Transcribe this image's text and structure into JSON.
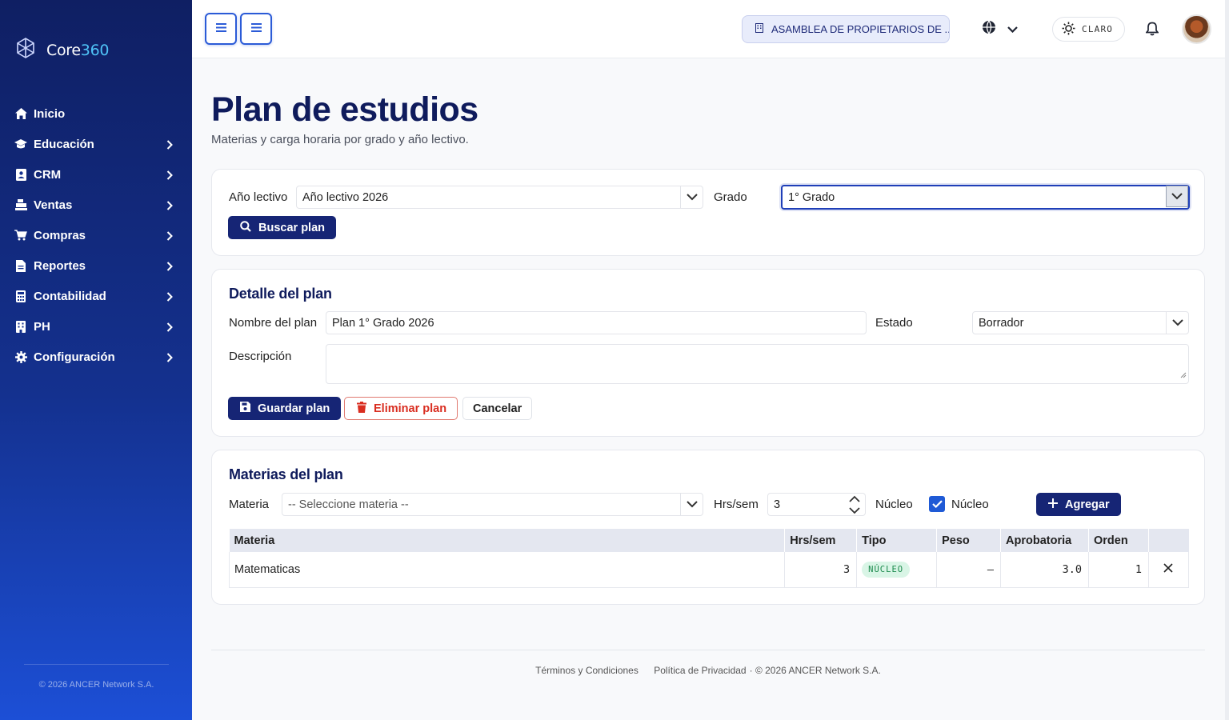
{
  "app": {
    "brand_prefix": "Core",
    "brand_suffix": "360",
    "copyright": "© 2026 ANCER Network S.A."
  },
  "sidebar": {
    "items": [
      {
        "label": "Inicio",
        "icon": "home-icon",
        "has_children": false
      },
      {
        "label": "Educación",
        "icon": "graduation-cap-icon",
        "has_children": true
      },
      {
        "label": "CRM",
        "icon": "contact-book-icon",
        "has_children": true
      },
      {
        "label": "Ventas",
        "icon": "cash-register-icon",
        "has_children": true
      },
      {
        "label": "Compras",
        "icon": "cart-icon",
        "has_children": true
      },
      {
        "label": "Reportes",
        "icon": "report-file-icon",
        "has_children": true
      },
      {
        "label": "Contabilidad",
        "icon": "calculator-icon",
        "has_children": true
      },
      {
        "label": "PH",
        "icon": "building-icon",
        "has_children": true
      },
      {
        "label": "Configuración",
        "icon": "gear-icon",
        "has_children": true
      }
    ]
  },
  "topbar": {
    "organization": "ASAMBLEA DE PROPIETARIOS DE ...",
    "theme_label": "CLARO"
  },
  "page": {
    "title": "Plan de estudios",
    "subtitle": "Materias y carga horaria por grado y año lectivo."
  },
  "filters": {
    "year_label": "Año lectivo",
    "year_value": "Año lectivo 2026",
    "grade_label": "Grado",
    "grade_value": "1° Grado",
    "search_button": "Buscar plan"
  },
  "detail": {
    "title": "Detalle del plan",
    "name_label": "Nombre del plan",
    "name_value": "Plan 1° Grado 2026",
    "status_label": "Estado",
    "status_value": "Borrador",
    "description_label": "Descripción",
    "description_value": "",
    "save_button": "Guardar plan",
    "delete_button": "Eliminar plan",
    "cancel_button": "Cancelar"
  },
  "subjects": {
    "title": "Materias del plan",
    "subject_label": "Materia",
    "subject_placeholder": "-- Seleccione materia --",
    "hours_label": "Hrs/sem",
    "hours_value": "3",
    "core_label": "Núcleo",
    "core_checkbox_label": "Núcleo",
    "core_checked": true,
    "add_button": "Agregar",
    "columns": [
      "Materia",
      "Hrs/sem",
      "Tipo",
      "Peso",
      "Aprobatoria",
      "Orden",
      ""
    ],
    "rows": [
      {
        "materia": "Matematicas",
        "hrs": "3",
        "tipo": "NÚCLEO",
        "peso": "—",
        "aprobatoria": "3.0",
        "orden": "1"
      }
    ]
  },
  "footer": {
    "terms": "Términos y Condiciones",
    "privacy": "Política de Privacidad",
    "copyright": "· © 2026 ANCER Network S.A."
  },
  "colors": {
    "sidebar_top": "#0f1f63",
    "sidebar_bottom": "#1c4fd6",
    "primary": "#162575",
    "danger": "#d92d20",
    "accent": "#2b5bd7",
    "badge_bg": "#d9f5e6",
    "badge_text": "#1b8a4c"
  }
}
